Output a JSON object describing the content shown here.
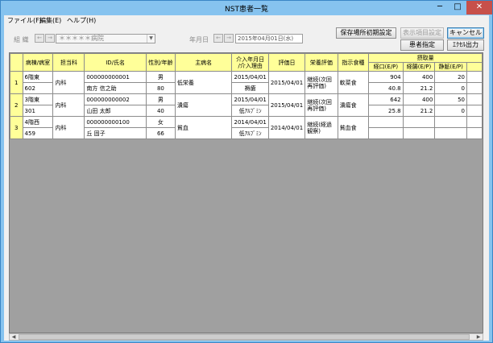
{
  "window": {
    "title": "NST患者一覧",
    "minimize": "─",
    "maximize": "□",
    "close": "✕"
  },
  "menu": [
    "ファイル(F)",
    "編集(E)",
    "ヘルプ(H)"
  ],
  "filters": {
    "ward_label": "組 織",
    "ward_value": "＊＊＊＊＊病院",
    "date_label": "年月日",
    "date_value": "2015年04月01日(水)",
    "prev": "←",
    "next": "→",
    "dropdown_arrow": "▼"
  },
  "buttons": {
    "save_layout": "保存場所初期設定",
    "display_settings": "表示項目設定",
    "cancel": "キャンセル",
    "patient_select": "患者指定",
    "excel_export": "ｴｸｾﾙ出力"
  },
  "table": {
    "headers": {
      "ward_room": "病棟/病室",
      "dept": "担当科",
      "id_name": "ID/氏名",
      "sex_age": "性別/年齢",
      "disease": "主病名",
      "intervention": "介入年月日\n/介入理由",
      "eval_date": "評価日",
      "nutrition_eval": "栄養評価",
      "diet": "指示食種",
      "intake_group": "摂取量",
      "oral": "経口(E/P)",
      "tube": "経腸(E/P)",
      "iv": "静脈(E/P)"
    },
    "rows": [
      {
        "num": "1",
        "ward": "6階東",
        "room": "602",
        "dept": "内科",
        "id": "000000000001",
        "name": "南方 信之助",
        "sex": "男",
        "age": "80",
        "disease": "低栄養",
        "intervention_date": "2015/04/01",
        "intervention_reason": "褥瘡",
        "eval_date": "2015/04/01",
        "nutrition_eval": "継続(次回再評価)",
        "diet": "軟菜食",
        "oral_e": "904",
        "oral_p": "40.8",
        "tube_e": "400",
        "tube_p": "21.2",
        "iv_e": "20",
        "iv_p": "0"
      },
      {
        "num": "2",
        "ward": "3階東",
        "room": "301",
        "dept": "内科",
        "id": "000000000002",
        "name": "山田 太郎",
        "sex": "男",
        "age": "40",
        "disease": "潰瘍",
        "intervention_date": "2015/04/01",
        "intervention_reason": "低ｱﾙﾌﾞﾐﾝ",
        "eval_date": "2015/04/01",
        "nutrition_eval": "継続(次回再評価)",
        "diet": "潰瘍食",
        "oral_e": "642",
        "oral_p": "25.8",
        "tube_e": "400",
        "tube_p": "21.2",
        "iv_e": "50",
        "iv_p": "0"
      },
      {
        "num": "3",
        "ward": "4階西",
        "room": "459",
        "dept": "内科",
        "id": "000000000100",
        "name": "丘 固子",
        "sex": "女",
        "age": "66",
        "disease": "貧血",
        "intervention_date": "2014/04/01",
        "intervention_reason": "低ｱﾙﾌﾞﾐﾝ",
        "eval_date": "2014/04/01",
        "nutrition_eval": "継続(経過観察)",
        "diet": "貧血食",
        "oral_e": "",
        "oral_p": "",
        "tube_e": "",
        "tube_p": "",
        "iv_e": "",
        "iv_p": ""
      }
    ]
  }
}
